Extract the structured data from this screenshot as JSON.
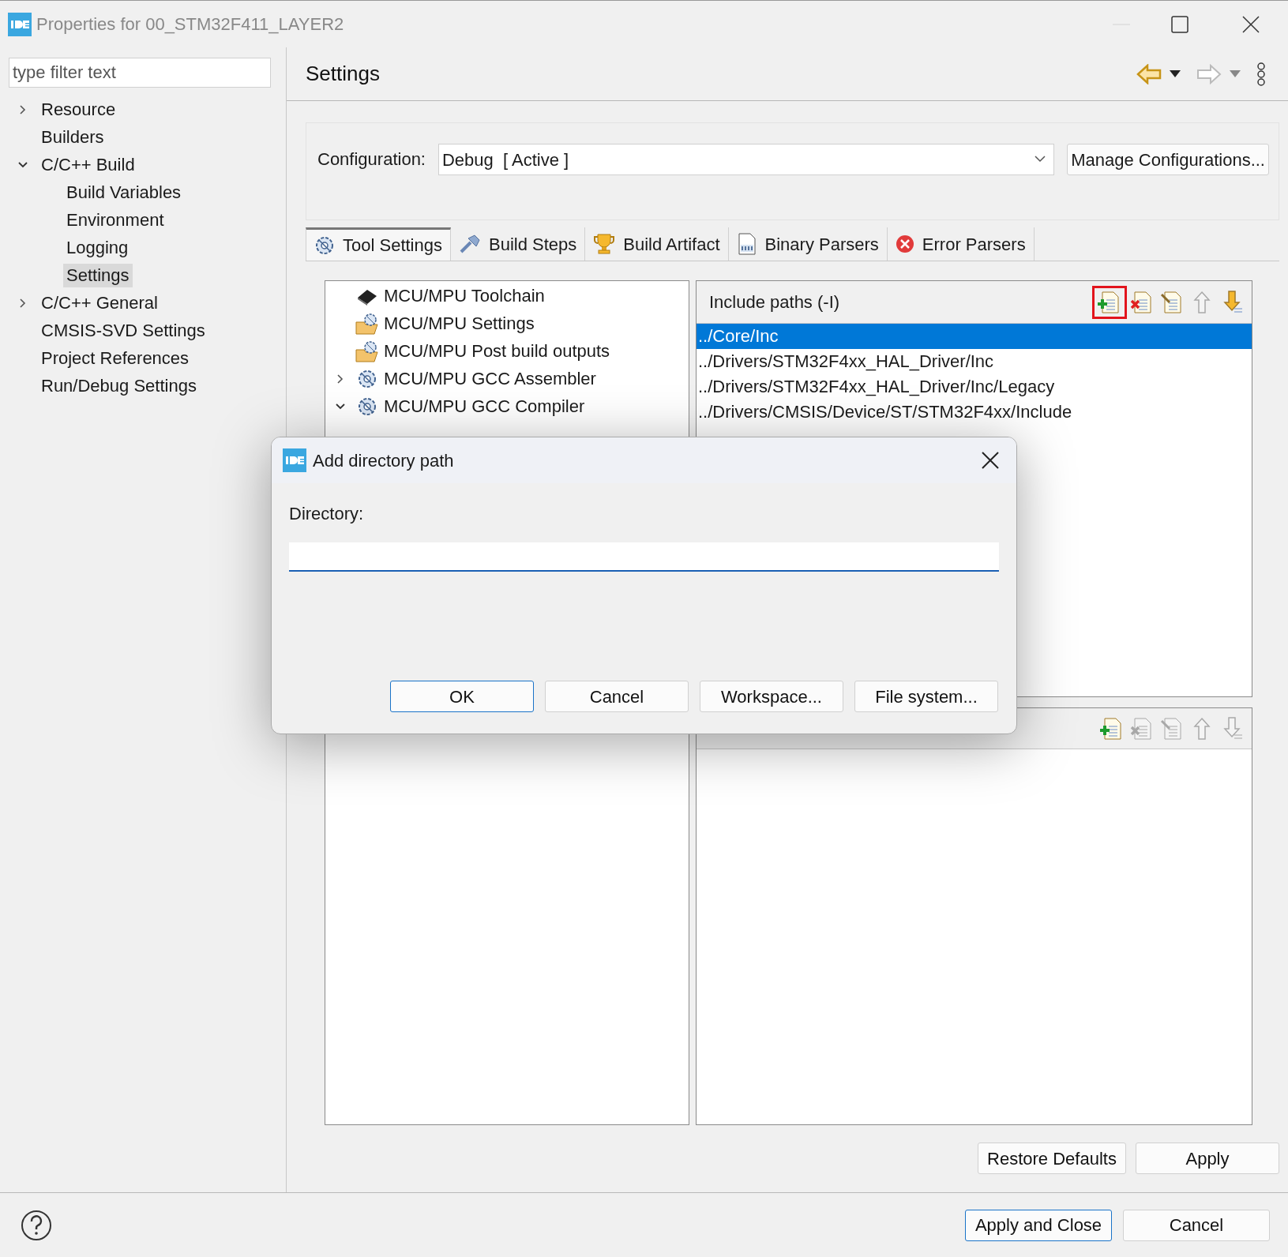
{
  "window": {
    "title": "Properties for 00_STM32F411_LAYER2"
  },
  "nav": {
    "filter": {
      "placeholder": "type filter text"
    },
    "items": [
      {
        "label": "Resource",
        "selected": false,
        "expanded": false
      },
      {
        "label": "Builders",
        "selected": false
      },
      {
        "label": "C/C++ Build",
        "selected": false,
        "expanded": true,
        "children": [
          {
            "label": "Build Variables",
            "selected": false
          },
          {
            "label": "Environment",
            "selected": false
          },
          {
            "label": "Logging",
            "selected": false
          },
          {
            "label": "Settings",
            "selected": true
          }
        ]
      },
      {
        "label": "C/C++ General",
        "selected": false,
        "expanded": false
      },
      {
        "label": "CMSIS-SVD Settings",
        "selected": false
      },
      {
        "label": "Project References",
        "selected": false
      },
      {
        "label": "Run/Debug Settings",
        "selected": false
      }
    ]
  },
  "page": {
    "title": "Settings",
    "configuration": {
      "label": "Configuration:",
      "value": "Debug  [ Active ]",
      "button": "Manage Configurations..."
    },
    "tabs": [
      {
        "label": "Tool Settings",
        "kind": "gear",
        "selected": true
      },
      {
        "label": "Build Steps",
        "kind": "wand",
        "selected": false
      },
      {
        "label": "Build Artifact",
        "kind": "trophy",
        "selected": false
      },
      {
        "label": "Binary Parsers",
        "kind": "binary",
        "selected": false
      },
      {
        "label": "Error Parsers",
        "kind": "error",
        "selected": false
      }
    ],
    "tool_tree": [
      {
        "label": "MCU/MPU Toolchain",
        "kind": "chip"
      },
      {
        "label": "MCU/MPU Settings",
        "kind": "folder"
      },
      {
        "label": "MCU/MPU Post build outputs",
        "kind": "folder"
      },
      {
        "label": "MCU/MPU GCC Assembler",
        "kind": "gear",
        "expanded": false
      },
      {
        "label": "MCU/MPU GCC Compiler",
        "kind": "gear",
        "expanded": true
      }
    ],
    "include_paths": {
      "title": "Include paths (-I)",
      "toolbar": [
        {
          "kind": "add",
          "disabled": false,
          "highlighted": true
        },
        {
          "kind": "delete",
          "disabled": false,
          "highlighted": false
        },
        {
          "kind": "edit",
          "disabled": false,
          "highlighted": false
        },
        {
          "kind": "up",
          "disabled": true,
          "highlighted": false
        },
        {
          "kind": "down",
          "disabled": false,
          "highlighted": false
        }
      ],
      "rows": [
        {
          "text": "../Core/Inc",
          "selected": true
        },
        {
          "text": "../Drivers/STM32F4xx_HAL_Driver/Inc",
          "selected": false
        },
        {
          "text": "../Drivers/STM32F4xx_HAL_Driver/Inc/Legacy",
          "selected": false
        },
        {
          "text": "../Drivers/CMSIS/Device/ST/STM32F4xx/Include",
          "selected": false
        }
      ]
    },
    "second_list": {
      "toolbar": [
        {
          "kind": "add",
          "disabled": false,
          "highlighted": false
        },
        {
          "kind": "delete",
          "disabled": true,
          "highlighted": false
        },
        {
          "kind": "edit",
          "disabled": true,
          "highlighted": false
        },
        {
          "kind": "up",
          "disabled": true,
          "highlighted": false
        },
        {
          "kind": "down",
          "disabled": true,
          "highlighted": false
        }
      ]
    },
    "buttons": [
      "Restore Defaults",
      "Apply"
    ]
  },
  "footer": {
    "buttons": [
      {
        "label": "Apply and Close",
        "default": true
      },
      {
        "label": "Cancel",
        "default": false
      }
    ]
  },
  "dialog": {
    "title": "Add directory path",
    "field_label": "Directory:",
    "buttons": [
      {
        "label": "OK",
        "default": true
      },
      {
        "label": "Cancel",
        "default": false
      },
      {
        "label": "Workspace...",
        "default": false
      },
      {
        "label": "File system...",
        "default": false
      }
    ]
  }
}
